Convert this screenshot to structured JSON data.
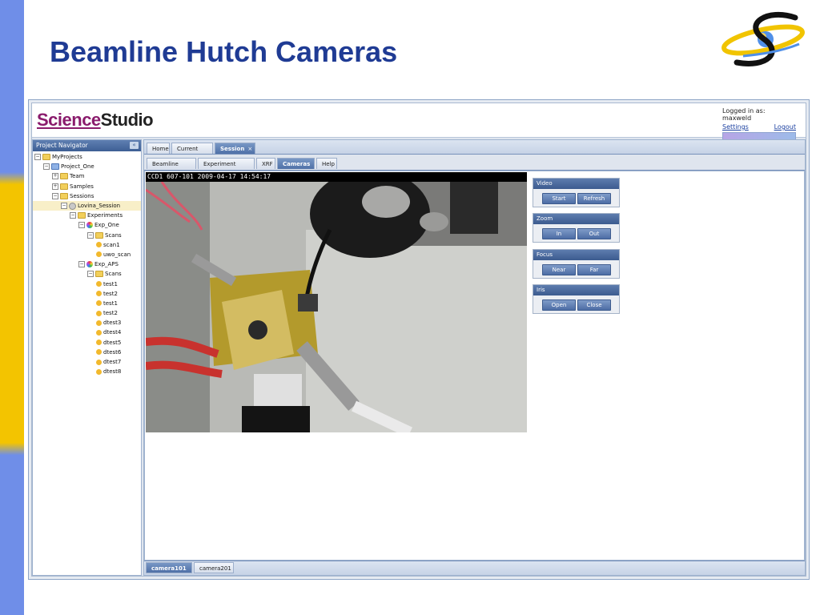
{
  "slide": {
    "title": "Beamline Hutch Cameras"
  },
  "colors": {
    "title": "#1f3b94",
    "brand_science": "#8a1b6c",
    "accent_left_blue": "#6f8ee8",
    "accent_left_yellow": "#f3c400",
    "tab_active": "#4f70a7"
  },
  "app": {
    "brand_part1": "Science",
    "brand_part2": "Studio",
    "login_label": "Logged in as: maxweld",
    "settings_link": "Settings",
    "logout_link": "Logout"
  },
  "nav": {
    "title": "Project Navigator",
    "collapse_icon": "double-chevron-left-icon",
    "tree": [
      {
        "label": "MyProjects",
        "level": 0,
        "toggle": "−",
        "icon": "folder"
      },
      {
        "label": "Project_One",
        "level": 1,
        "toggle": "−",
        "icon": "book"
      },
      {
        "label": "Team",
        "level": 2,
        "toggle": "+",
        "icon": "folder"
      },
      {
        "label": "Samples",
        "level": 2,
        "toggle": "+",
        "icon": "folder"
      },
      {
        "label": "Sessions",
        "level": 2,
        "toggle": "−",
        "icon": "folder"
      },
      {
        "label": "Lovina_Session",
        "level": 3,
        "toggle": "−",
        "icon": "gear",
        "selected": true
      },
      {
        "label": "Experiments",
        "level": 4,
        "toggle": "−",
        "icon": "folder"
      },
      {
        "label": "Exp_One",
        "level": 5,
        "toggle": "−",
        "icon": "globe"
      },
      {
        "label": "Scans",
        "level": 6,
        "toggle": "−",
        "icon": "folder"
      },
      {
        "label": "scan1",
        "level": 7,
        "toggle": "",
        "icon": "ball"
      },
      {
        "label": "uwo_scan",
        "level": 7,
        "toggle": "",
        "icon": "ball"
      },
      {
        "label": "Exp_APS",
        "level": 5,
        "toggle": "−",
        "icon": "globe"
      },
      {
        "label": "Scans",
        "level": 6,
        "toggle": "−",
        "icon": "folder"
      },
      {
        "label": "test1",
        "level": 7,
        "toggle": "",
        "icon": "ball"
      },
      {
        "label": "test2",
        "level": 7,
        "toggle": "",
        "icon": "ball"
      },
      {
        "label": "test1",
        "level": 7,
        "toggle": "",
        "icon": "ball"
      },
      {
        "label": "test2",
        "level": 7,
        "toggle": "",
        "icon": "ball"
      },
      {
        "label": "dtest3",
        "level": 7,
        "toggle": "",
        "icon": "ball"
      },
      {
        "label": "dtest4",
        "level": 7,
        "toggle": "",
        "icon": "ball"
      },
      {
        "label": "dtest5",
        "level": 7,
        "toggle": "",
        "icon": "ball"
      },
      {
        "label": "dtest6",
        "level": 7,
        "toggle": "",
        "icon": "ball"
      },
      {
        "label": "dtest7",
        "level": 7,
        "toggle": "",
        "icon": "ball"
      },
      {
        "label": "dtest8",
        "level": 7,
        "toggle": "",
        "icon": "ball"
      }
    ]
  },
  "top_tabs": [
    {
      "label": "Home"
    },
    {
      "label": "Current Item"
    },
    {
      "label": "Session",
      "active": true,
      "close": "×"
    }
  ],
  "sub_tabs": [
    {
      "label": "Beamline Setup"
    },
    {
      "label": "Experiment Setup"
    },
    {
      "label": "XRF"
    },
    {
      "label": "Cameras",
      "active": true
    },
    {
      "label": "Help"
    }
  ],
  "camera": {
    "overlay": "CCD1 607-101 2009-04-17 14:54:17"
  },
  "controls": [
    {
      "title": "Video",
      "buttons": [
        "Start",
        "Refresh"
      ]
    },
    {
      "title": "Zoom",
      "buttons": [
        "In",
        "Out"
      ]
    },
    {
      "title": "Focus",
      "buttons": [
        "Near",
        "Far"
      ]
    },
    {
      "title": "Iris",
      "buttons": [
        "Open",
        "Close"
      ]
    }
  ],
  "camera_tabs": [
    {
      "label": "camera101",
      "active": true
    },
    {
      "label": "camera201"
    }
  ]
}
